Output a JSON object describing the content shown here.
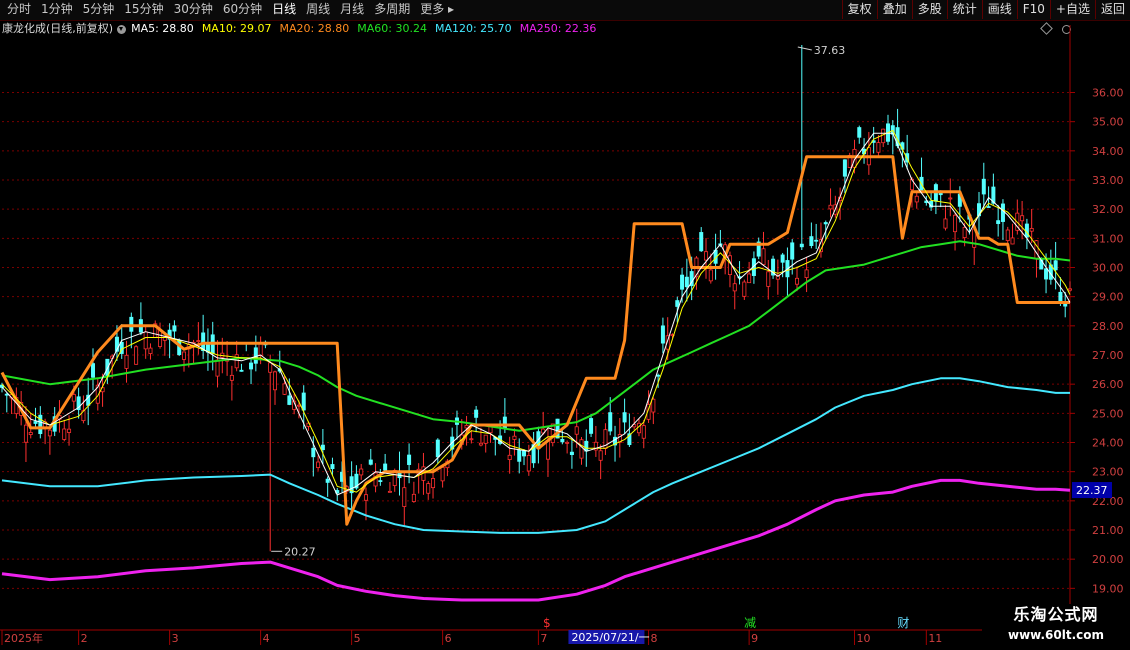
{
  "toolbar": {
    "periods": [
      "分时",
      "1分钟",
      "5分钟",
      "15分钟",
      "30分钟",
      "60分钟",
      "日线",
      "周线",
      "月线",
      "多周期",
      "更多 ▸"
    ],
    "active_index": 6,
    "buttons": [
      "复权",
      "叠加",
      "多股",
      "统计",
      "画线",
      "F10",
      "+自选",
      "返回"
    ]
  },
  "info": {
    "title": "康龙化成(日线,前复权)",
    "ma": [
      {
        "label": "MA5: 28.80",
        "color": "#ffffff"
      },
      {
        "label": "MA10: 29.07",
        "color": "#ffff00"
      },
      {
        "label": "MA20: 28.80",
        "color": "#ff8a1e"
      },
      {
        "label": "MA60: 30.24",
        "color": "#22e022"
      },
      {
        "label": "MA120: 25.70",
        "color": "#44e8ff"
      },
      {
        "label": "MA250: 22.36",
        "color": "#ee22ee"
      }
    ]
  },
  "chart_data": {
    "type": "line",
    "title": "康龙化成(日线,前复权)",
    "ylim": [
      18.6,
      37.8
    ],
    "yticks": [
      19.0,
      20.0,
      21.0,
      22.0,
      23.0,
      24.0,
      25.0,
      26.0,
      27.0,
      28.0,
      29.0,
      30.0,
      31.0,
      32.0,
      33.0,
      34.0,
      35.0,
      36.0
    ],
    "x_months": [
      {
        "label": "2025年",
        "t": 0
      },
      {
        "label": "2",
        "t": 16
      },
      {
        "label": "3",
        "t": 35
      },
      {
        "label": "4",
        "t": 54
      },
      {
        "label": "5",
        "t": 73
      },
      {
        "label": "6",
        "t": 92
      },
      {
        "label": "7",
        "t": 112
      },
      {
        "label": "8",
        "t": 135
      },
      {
        "label": "9",
        "t": 156
      },
      {
        "label": "10",
        "t": 178
      },
      {
        "label": "11",
        "t": 193
      }
    ],
    "cursor_date": "2025/07/21/一",
    "cursor_t": 126,
    "annotations": {
      "high": {
        "label": "37.63",
        "t": 167,
        "price": 37.63
      },
      "low": {
        "label": "20.27",
        "t": 56,
        "price": 20.27
      },
      "last_price": "22.37"
    },
    "events": [
      {
        "label": "$",
        "t": 114,
        "color": "#ff3030"
      },
      {
        "label": "减",
        "t": 156,
        "color": "#22e022"
      },
      {
        "label": "财",
        "t": 188,
        "color": "#66ddff"
      }
    ],
    "series": [
      {
        "name": "MA5",
        "color": "#ffffff",
        "width": 1,
        "x": [
          0,
          6,
          10,
          16,
          20,
          25,
          30,
          35,
          40,
          45,
          50,
          54,
          58,
          62,
          66,
          70,
          74,
          78,
          82,
          86,
          90,
          94,
          98,
          102,
          106,
          110,
          114,
          118,
          122,
          126,
          130,
          134,
          138,
          142,
          146,
          150,
          154,
          158,
          162,
          166,
          170,
          174,
          178,
          182,
          186,
          190,
          194,
          198,
          202,
          206,
          210,
          214,
          218,
          222,
          223
        ],
        "y": [
          25.9,
          24.8,
          24.6,
          25.2,
          25.9,
          27.5,
          27.8,
          27.6,
          27.4,
          26.9,
          26.8,
          27.0,
          26.5,
          25.0,
          23.6,
          22.2,
          22.5,
          23.0,
          22.9,
          22.8,
          23.3,
          24.0,
          24.6,
          24.3,
          23.8,
          23.7,
          24.5,
          24.3,
          23.7,
          23.9,
          24.3,
          25.0,
          27.0,
          29.0,
          30.0,
          30.8,
          29.6,
          30.2,
          29.7,
          30.2,
          30.5,
          32.0,
          33.7,
          34.6,
          34.6,
          33.0,
          32.1,
          32.1,
          31.2,
          32.4,
          31.8,
          31.0,
          30.0,
          29.1,
          28.8
        ]
      },
      {
        "name": "MA10",
        "color": "#ffff00",
        "width": 1,
        "x": [
          0,
          6,
          10,
          16,
          20,
          25,
          30,
          35,
          40,
          45,
          50,
          54,
          58,
          62,
          66,
          70,
          74,
          78,
          82,
          86,
          90,
          94,
          98,
          102,
          106,
          110,
          114,
          118,
          122,
          126,
          130,
          134,
          138,
          142,
          146,
          150,
          154,
          158,
          162,
          166,
          170,
          174,
          178,
          182,
          186,
          190,
          194,
          198,
          202,
          206,
          210,
          214,
          218,
          222,
          223
        ],
        "y": [
          26.0,
          25.0,
          24.6,
          24.9,
          25.6,
          27.2,
          27.6,
          27.6,
          27.3,
          27.0,
          26.9,
          26.9,
          26.6,
          25.4,
          24.0,
          22.5,
          22.3,
          22.8,
          22.9,
          22.8,
          23.1,
          23.8,
          24.4,
          24.3,
          23.9,
          23.7,
          24.2,
          24.2,
          23.8,
          23.8,
          24.1,
          24.7,
          26.5,
          28.6,
          29.8,
          30.5,
          29.8,
          30.0,
          29.8,
          30.0,
          30.3,
          31.6,
          33.4,
          34.4,
          34.7,
          33.4,
          32.3,
          32.2,
          31.4,
          32.2,
          31.9,
          31.2,
          30.3,
          29.4,
          29.07
        ]
      },
      {
        "name": "MA20",
        "color": "#ff8a1e",
        "width": 3,
        "x": [
          0,
          6,
          10,
          15,
          20,
          25,
          28,
          32,
          38,
          42,
          46,
          50,
          56,
          62,
          66,
          70,
          72,
          74,
          76,
          80,
          86,
          90,
          94,
          96,
          98,
          100,
          104,
          108,
          112,
          118,
          122,
          124,
          128,
          130,
          132,
          136,
          140,
          142,
          144,
          146,
          150,
          152,
          154,
          158,
          160,
          164,
          168,
          172,
          176,
          180,
          184,
          186,
          188,
          190,
          194,
          196,
          198,
          200,
          204,
          206,
          208,
          210,
          212,
          214,
          218,
          223
        ],
        "y": [
          26.4,
          24.5,
          24.5,
          25.8,
          27.1,
          28.0,
          28.0,
          28.0,
          27.2,
          27.4,
          27.4,
          27.4,
          27.4,
          27.4,
          27.4,
          27.4,
          21.2,
          22.0,
          22.6,
          23.0,
          23.0,
          23.0,
          23.4,
          24.0,
          24.6,
          24.6,
          24.6,
          24.6,
          23.8,
          24.6,
          26.2,
          26.2,
          26.2,
          27.5,
          31.5,
          31.5,
          31.5,
          31.5,
          30.0,
          30.0,
          30.0,
          30.8,
          30.8,
          30.8,
          30.8,
          31.2,
          33.8,
          33.8,
          33.8,
          33.8,
          33.8,
          33.8,
          31.0,
          32.6,
          32.6,
          32.6,
          32.6,
          32.6,
          31.0,
          31.0,
          30.8,
          30.8,
          28.8,
          28.8,
          28.8,
          28.8
        ]
      },
      {
        "name": "MA60",
        "color": "#22e022",
        "width": 2,
        "x": [
          0,
          10,
          20,
          30,
          40,
          50,
          58,
          62,
          66,
          70,
          74,
          80,
          86,
          90,
          96,
          100,
          104,
          108,
          112,
          116,
          120,
          124,
          128,
          132,
          136,
          140,
          144,
          148,
          152,
          156,
          160,
          164,
          168,
          172,
          176,
          180,
          184,
          188,
          192,
          196,
          200,
          204,
          208,
          212,
          216,
          220,
          223
        ],
        "y": [
          26.3,
          26.0,
          26.2,
          26.5,
          26.7,
          26.9,
          26.8,
          26.6,
          26.3,
          25.9,
          25.6,
          25.3,
          25.0,
          24.8,
          24.7,
          24.6,
          24.5,
          24.4,
          24.5,
          24.6,
          24.7,
          25.0,
          25.5,
          26.0,
          26.5,
          26.8,
          27.1,
          27.4,
          27.7,
          28.0,
          28.5,
          29.0,
          29.5,
          29.9,
          30.0,
          30.1,
          30.3,
          30.5,
          30.7,
          30.8,
          30.9,
          30.8,
          30.6,
          30.4,
          30.3,
          30.3,
          30.24
        ]
      },
      {
        "name": "MA120",
        "color": "#44e8ff",
        "width": 2,
        "x": [
          0,
          10,
          20,
          30,
          40,
          50,
          56,
          60,
          66,
          70,
          76,
          82,
          88,
          96,
          104,
          112,
          120,
          126,
          130,
          136,
          140,
          146,
          152,
          158,
          164,
          170,
          174,
          180,
          186,
          190,
          196,
          200,
          204,
          210,
          216,
          220,
          223
        ],
        "y": [
          22.7,
          22.5,
          22.5,
          22.7,
          22.8,
          22.85,
          22.9,
          22.6,
          22.2,
          21.9,
          21.5,
          21.2,
          21.0,
          20.95,
          20.9,
          20.9,
          21.0,
          21.3,
          21.7,
          22.3,
          22.6,
          23.0,
          23.4,
          23.8,
          24.3,
          24.8,
          25.2,
          25.6,
          25.8,
          26.0,
          26.2,
          26.2,
          26.1,
          25.9,
          25.8,
          25.7,
          25.7
        ]
      },
      {
        "name": "MA250",
        "color": "#ee22ee",
        "width": 3,
        "x": [
          0,
          10,
          20,
          30,
          40,
          50,
          56,
          60,
          66,
          70,
          76,
          82,
          88,
          96,
          104,
          112,
          120,
          126,
          130,
          136,
          140,
          146,
          152,
          158,
          164,
          170,
          174,
          180,
          186,
          190,
          196,
          200,
          204,
          210,
          216,
          220,
          223
        ],
        "y": [
          19.5,
          19.3,
          19.4,
          19.6,
          19.7,
          19.85,
          19.9,
          19.7,
          19.4,
          19.1,
          18.9,
          18.75,
          18.65,
          18.6,
          18.6,
          18.6,
          18.8,
          19.1,
          19.4,
          19.7,
          19.9,
          20.2,
          20.5,
          20.8,
          21.2,
          21.7,
          22.0,
          22.2,
          22.3,
          22.5,
          22.7,
          22.7,
          22.6,
          22.5,
          22.4,
          22.4,
          22.36
        ]
      }
    ]
  },
  "watermark": {
    "line1": "乐淘公式网",
    "line2": "www.60lt.com"
  }
}
